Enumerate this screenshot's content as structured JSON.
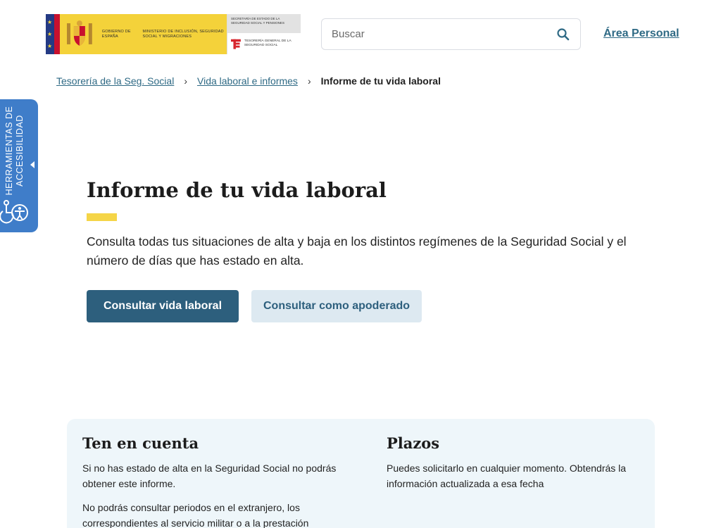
{
  "header": {
    "logo": {
      "gobierno": "GOBIERNO DE ESPAÑA",
      "ministerio": "MINISTERIO DE INCLUSIÓN, SEGURIDAD SOCIAL Y MIGRACIONES",
      "secretaria": "SECRETARÍA DE ESTADO DE LA SEGURIDAD SOCIAL Y PENSIONES",
      "tesoreria": "TESORERÍA GENERAL DE LA SEGURIDAD SOCIAL"
    },
    "search_placeholder": "Buscar",
    "area_personal": "Área Personal"
  },
  "breadcrumb": {
    "items": [
      "Tesorería de la Seg. Social",
      "Vida laboral e informes"
    ],
    "current": "Informe de tu vida laboral"
  },
  "accessibility": {
    "label": "HERRAMIENTAS DE ACCESIBILIDAD"
  },
  "hero": {
    "title": "Informe de tu vida laboral",
    "description": "Consulta todas tus situaciones de alta y baja en los distintos regímenes de la Seguridad Social y el número de días que has estado en alta.",
    "primary_button": "Consultar vida laboral",
    "secondary_button": "Consultar como apoderado"
  },
  "info": {
    "left": {
      "title": "Ten en cuenta",
      "paragraphs": [
        "Si no has estado de alta en la Seguridad Social no podrás obtener este informe.",
        "No podrás consultar periodos en el extranjero, los correspondientes al servicio militar o a la prestación"
      ]
    },
    "right": {
      "title": "Plazos",
      "paragraphs": [
        "Puedes solicitarlo en cualquier momento. Obtendrás la información actualizada a esa fecha"
      ]
    }
  },
  "colors": {
    "primary": "#2d5f7d",
    "link": "#2f6a85",
    "accent_yellow": "#f5d547",
    "accessibility_blue": "#3f7dc9",
    "panel_bg": "#eef6fa"
  }
}
